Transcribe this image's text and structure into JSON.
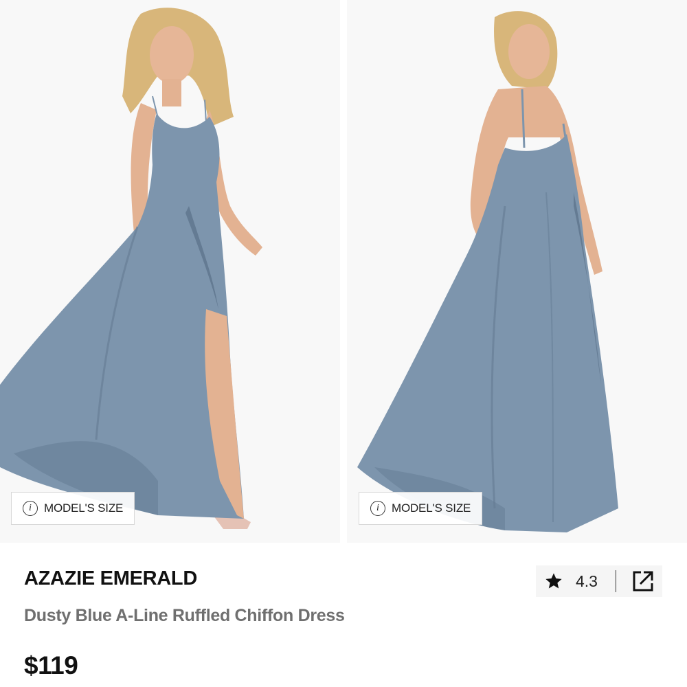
{
  "gallery": {
    "images": [
      {
        "description_icon": "model-front-photo"
      },
      {
        "description_icon": "model-back-photo"
      }
    ],
    "model_size_label": "MODEL'S SIZE",
    "info_icon": "i"
  },
  "product": {
    "brand": "AZAZIE EMERALD",
    "name": "Dusty Blue A-Line Ruffled Chiffon Dress",
    "price": "$119",
    "rating": "4.3"
  },
  "colors": {
    "dress": "#7d95ad",
    "dress_shadow": "#647b93",
    "skin": "#e6b697",
    "hair": "#d8b67a",
    "background": "#f8f8f8",
    "secondary_text": "#6f6f6f",
    "rating_bg": "#f5f5f5"
  }
}
